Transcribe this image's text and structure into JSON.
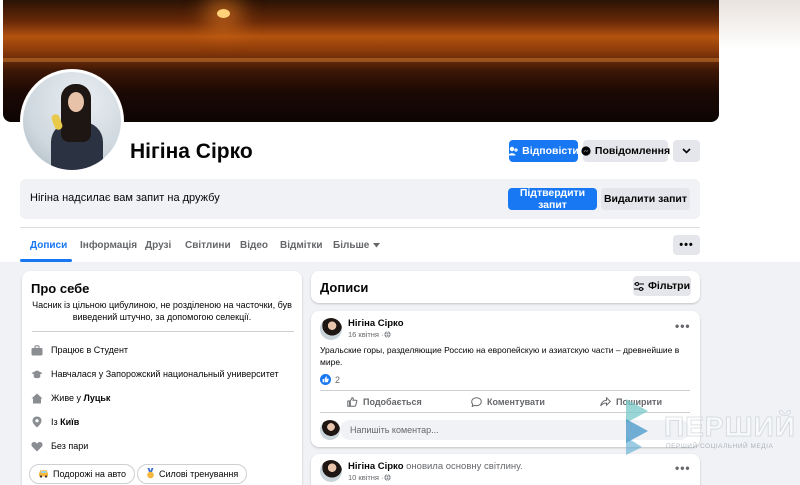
{
  "profile": {
    "name": "Нігіна Сірко"
  },
  "actions": {
    "respond_label": "Відповісти",
    "message_label": "Повідомлення"
  },
  "friend_request": {
    "text": "Нігіна надсилає вам запит на дружбу",
    "confirm_label": "Підтвердити запит",
    "delete_label": "Видалити запит"
  },
  "tabs": [
    {
      "label": "Дописи"
    },
    {
      "label": "Інформація"
    },
    {
      "label": "Друзі"
    },
    {
      "label": "Світлини"
    },
    {
      "label": "Відео"
    },
    {
      "label": "Відмітки"
    },
    {
      "label": "Більше"
    }
  ],
  "intro": {
    "title": "Про себе",
    "bio": "Часник із цільною цибулиною, не розділеною на часточки, був виведений штучно, за допомогою селекції.",
    "work": "Працює в Студент",
    "education": "Навчалася у Запорожский национальный университет",
    "lives_prefix": "Живе у ",
    "lives_city": "Луцьк",
    "from_prefix": "Із ",
    "from_city": "Київ",
    "relationship": "Без пари",
    "hobbies": [
      {
        "label": "Подорожі на авто"
      },
      {
        "label": "Силові тренування"
      }
    ]
  },
  "posts_header": {
    "title": "Дописи",
    "filters_label": "Фільтри"
  },
  "posts": [
    {
      "author": "Нігіна Сірко",
      "date": "16 квітня · ",
      "text": "Уральские горы, разделяющие Россию на европейскую и азиатскую части – древнейшие в мире.",
      "likes": "2",
      "like_label": "Подобається",
      "comment_label": "Коментувати",
      "share_label": "Поширити",
      "comment_placeholder": "Напишіть коментар..."
    },
    {
      "author": "Нігіна Сірко",
      "action": " оновила основну світлину.",
      "date": "10 квітня · "
    }
  ],
  "watermark": {
    "text": "ПЕРШИЙ",
    "subtext": "ПЕРШИЙ СОЦІАЛЬНИЙ МЕДІА"
  },
  "colors": {
    "accent": "#1877f2",
    "page_bg": "#f0f2f5",
    "button_gray": "#e4e6eb"
  }
}
